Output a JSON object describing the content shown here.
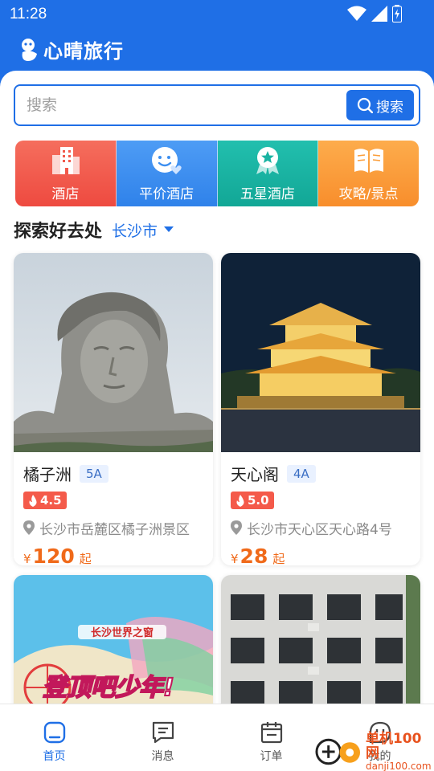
{
  "status": {
    "time": "11:28"
  },
  "brand": {
    "title": "心晴旅行"
  },
  "search": {
    "placeholder": "搜索",
    "button_label": "搜索"
  },
  "categories": [
    {
      "label": "酒店",
      "icon": "building-icon",
      "color": "#f2594b"
    },
    {
      "label": "平价酒店",
      "icon": "smiley-heart-icon",
      "color": "#3d8ff0"
    },
    {
      "label": "五星酒店",
      "icon": "star-badge-icon",
      "color": "#19b3a2"
    },
    {
      "label": "攻略/景点",
      "icon": "book-icon",
      "color": "#fb9e3a"
    }
  ],
  "explore": {
    "title": "探索好去处",
    "city": "长沙市"
  },
  "places": [
    {
      "name": "橘子洲",
      "level": "5A",
      "rating": "4.5",
      "address": "长沙市岳麓区橘子洲景区",
      "currency": "¥",
      "price": "120",
      "price_suffix": "起"
    },
    {
      "name": "天心阁",
      "level": "4A",
      "rating": "5.0",
      "address": "长沙市天心区天心路4号",
      "currency": "¥",
      "price": "28",
      "price_suffix": "起"
    },
    {
      "poster_brand": "长沙世界之窗",
      "poster_slogan": "登顶吧少年!"
    },
    {}
  ],
  "tabbar": [
    {
      "label": "首页",
      "icon": "home-icon",
      "active": true
    },
    {
      "label": "消息",
      "icon": "message-icon",
      "active": false
    },
    {
      "label": "订单",
      "icon": "calendar-icon",
      "active": false
    },
    {
      "label": "我的",
      "icon": "profile-icon",
      "active": false
    }
  ],
  "watermark": {
    "line1": "单机100网",
    "line2": "danji100.com"
  },
  "colors": {
    "primary": "#1f6fe6",
    "price": "#f06a1a",
    "rating_bg": "#f45a4a"
  }
}
